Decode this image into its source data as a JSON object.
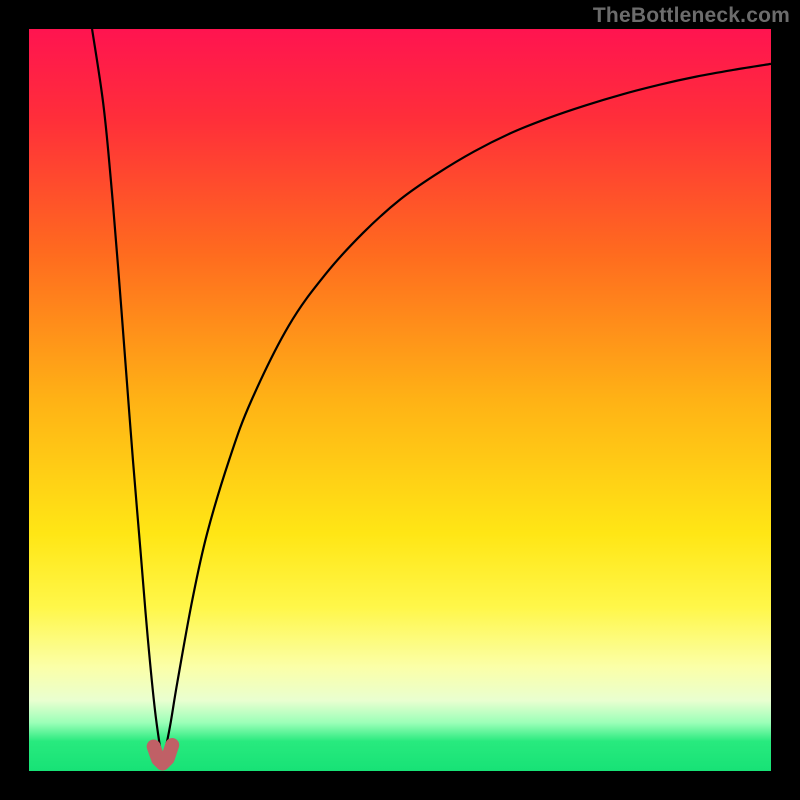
{
  "watermark": "TheBottleneck.com",
  "colors": {
    "frame": "#000000",
    "curve": "#000000",
    "marker": "#c06066",
    "gradient_stops": [
      {
        "offset": 0.0,
        "color": "#ff1450"
      },
      {
        "offset": 0.12,
        "color": "#ff2e3a"
      },
      {
        "offset": 0.3,
        "color": "#ff6a1f"
      },
      {
        "offset": 0.5,
        "color": "#ffb215"
      },
      {
        "offset": 0.68,
        "color": "#ffe615"
      },
      {
        "offset": 0.78,
        "color": "#fff74a"
      },
      {
        "offset": 0.86,
        "color": "#fbffa8"
      },
      {
        "offset": 0.905,
        "color": "#e9ffd0"
      },
      {
        "offset": 0.935,
        "color": "#9bffb8"
      },
      {
        "offset": 0.96,
        "color": "#28ea7e"
      },
      {
        "offset": 1.0,
        "color": "#17e276"
      }
    ]
  },
  "chart_data": {
    "type": "line",
    "title": "",
    "xlabel": "",
    "ylabel": "",
    "xlim": [
      0,
      100
    ],
    "ylim": [
      0,
      100
    ],
    "grid": false,
    "annotations": [],
    "x_minimum": 18,
    "series": [
      {
        "name": "left-branch",
        "x": [
          8.5,
          10,
          11,
          12,
          13,
          14,
          15,
          16,
          17,
          18
        ],
        "y": [
          100,
          90,
          80,
          68,
          55,
          42,
          30,
          18,
          8,
          1
        ]
      },
      {
        "name": "right-branch",
        "x": [
          18,
          19,
          20,
          22,
          24,
          27,
          30,
          35,
          40,
          45,
          50,
          55,
          60,
          65,
          70,
          75,
          80,
          85,
          90,
          95,
          100
        ],
        "y": [
          1,
          6,
          12,
          23,
          32,
          42,
          50,
          60,
          67,
          72.5,
          77,
          80.5,
          83.5,
          86,
          88,
          89.7,
          91.2,
          92.5,
          93.6,
          94.5,
          95.3
        ]
      }
    ],
    "marker_points": [
      {
        "x": 16.8,
        "y": 3.3
      },
      {
        "x": 17.4,
        "y": 1.6
      },
      {
        "x": 18.0,
        "y": 1.0
      },
      {
        "x": 18.7,
        "y": 1.7
      },
      {
        "x": 19.3,
        "y": 3.5
      }
    ]
  }
}
